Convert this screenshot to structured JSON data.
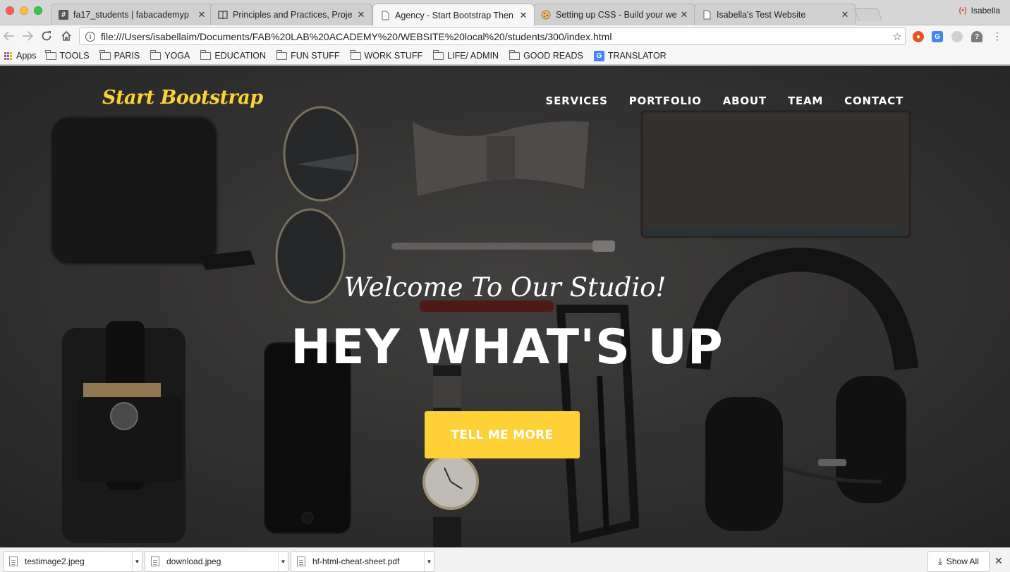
{
  "browser": {
    "tabs": [
      {
        "title": "fa17_students | fabacademyp",
        "icon": "hash-icon",
        "active": false
      },
      {
        "title": "Principles and Practices, Proje",
        "icon": "book-icon",
        "active": false
      },
      {
        "title": "Agency - Start Bootstrap Then",
        "icon": "document-icon",
        "active": true
      },
      {
        "title": "Setting up CSS - Build your we",
        "icon": "cookie-icon",
        "active": false
      },
      {
        "title": "Isabella's Test Website",
        "icon": "document-icon",
        "active": false
      }
    ],
    "profile_name": "Isabella",
    "url": "file:///Users/isabellaim/Documents/FAB%20LAB%20ACADEMY%20/WEBSITE%20local%20/students/300/index.html",
    "bookmarks": {
      "apps_label": "Apps",
      "folders": [
        "TOOLS",
        "PARIS",
        "YOGA",
        "EDUCATION",
        "FUN STUFF",
        "WORK STUFF",
        "LIFE/ ADMIN",
        "GOOD READS"
      ],
      "translator_label": "TRANSLATOR"
    }
  },
  "site": {
    "brand": "Start Bootstrap",
    "nav": [
      "SERVICES",
      "PORTFOLIO",
      "ABOUT",
      "TEAM",
      "CONTACT"
    ],
    "lead": "Welcome To Our Studio!",
    "heading": "HEY WHAT'S UP",
    "cta": "TELL ME MORE",
    "accent": "#fed136"
  },
  "downloads": {
    "items": [
      "testimage2.jpeg",
      "download.jpeg",
      "hf-html-cheat-sheet.pdf"
    ],
    "show_all": "Show All"
  }
}
